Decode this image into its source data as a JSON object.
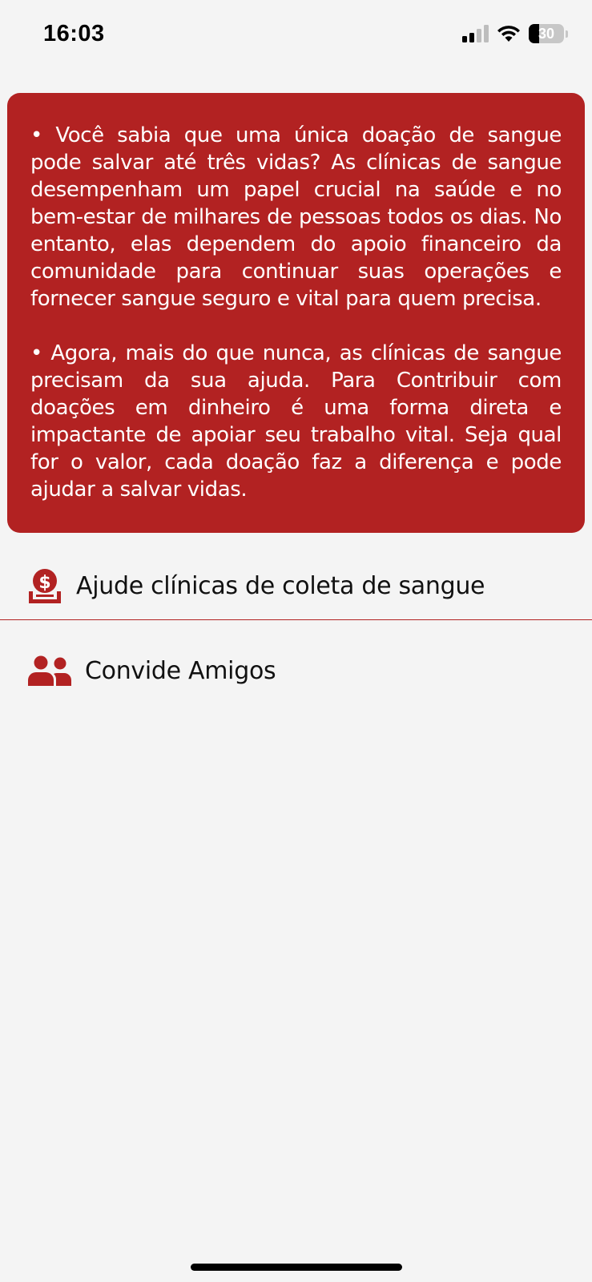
{
  "status_bar": {
    "time": "16:03",
    "battery_level": "30",
    "icons": [
      "cellular-signal-icon",
      "wifi-icon",
      "battery-icon"
    ]
  },
  "info_card": {
    "background_color": "#b22222",
    "paragraphs": [
      "• Você sabia que uma única doação de sangue pode salvar até três vidas? As clínicas de sangue desempenham um papel crucial na saúde e no bem-estar de milhares de pessoas todos os dias. No entanto, elas dependem do apoio financeiro da comunidade para continuar suas operações e fornecer sangue seguro e vital para quem precisa.",
      "• Agora, mais do que nunca, as clínicas de sangue precisam da sua ajuda. Para Contribuir com doações em dinheiro é uma forma direta e impactante de apoiar seu trabalho vital. Seja qual for o valor, cada doação faz a diferença e pode ajudar a salvar vidas."
    ]
  },
  "menu": {
    "accent_color": "#b22222",
    "items": [
      {
        "label": "Ajude clínicas de coleta de sangue",
        "icon": "donate-money-icon"
      },
      {
        "label": "Convide Amigos",
        "icon": "users-icon"
      }
    ]
  }
}
